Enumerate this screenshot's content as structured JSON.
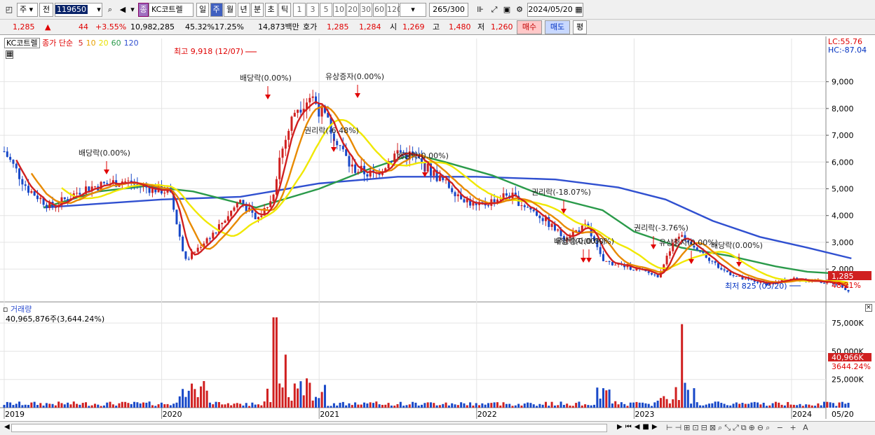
{
  "toolbar": {
    "market": "주",
    "prev": "전",
    "code": "119650",
    "name": "KC코트렐",
    "name_badge": "종",
    "periods": [
      "일",
      "주",
      "월",
      "년",
      "분",
      "초",
      "틱"
    ],
    "nums": [
      "1",
      "3",
      "5",
      "10",
      "20",
      "30",
      "60",
      "120"
    ],
    "count": "265",
    "count_total": "/300",
    "date": "2024/05/20"
  },
  "quote": {
    "price": "1,285",
    "arrow": "▲",
    "change": "44",
    "pct": "+3.55%",
    "volume": "10,982,285",
    "vol_pct": "45.32%",
    "turnover": "17.25%",
    "amount": "14,873백만",
    "ask_label": "호가",
    "ask": "1,285",
    "bid": "1,284",
    "open_label": "시",
    "open": "1,269",
    "high_label": "고",
    "high": "1,480",
    "low_label": "저",
    "low": "1,260",
    "buy": "매수",
    "sell": "매도",
    "eval": "평"
  },
  "legend": {
    "name": "KC코트렐",
    "type": "종가 단순",
    "ma": [
      "5",
      "10",
      "20",
      "60",
      "120"
    ],
    "ma_colors": [
      "#d02020",
      "#e8a000",
      "#e8e000",
      "#2a9a4a",
      "#3050d0"
    ]
  },
  "annotations": {
    "high": "최고 9,918 (12/07)",
    "low": "최저 825 (05/20)",
    "events": [
      "배당락(0.00%)",
      "배당락(0.00%)",
      "유상증자(0.00%)",
      "권리락(-6.48%)",
      "배당락(0.00%)",
      "권리락(-18.07%)",
      "배당락(0.00%)",
      "유상증자(0.00%)",
      "권리락(-3.76%)",
      "유상증자(0.00%)",
      "배당락(0.00%)"
    ]
  },
  "price_axis": {
    "lc": "LC:55.76",
    "hc": "HC:-87.04",
    "ticks": [
      "9,000",
      "8,000",
      "7,000",
      "6,000",
      "5,000",
      "4,000",
      "3,000",
      "2,000"
    ],
    "current": "1,285",
    "current_pct": "48.21%"
  },
  "volume_panel": {
    "title": "거래량",
    "info": "40,965,876주(3,644.24%)",
    "ticks": [
      "75,000K",
      "50,000K",
      "25,000K"
    ],
    "current": "40,966K",
    "current_pct": "3644.24%"
  },
  "x_axis": {
    "labels": [
      "2019",
      "2020",
      "2021",
      "2022",
      "2023",
      "2024"
    ],
    "last": "05/20"
  },
  "colors": {
    "up": "#d02020",
    "down": "#1848c8",
    "ma5": "#d02020",
    "ma10": "#e88a00",
    "ma20": "#f0e800",
    "ma60": "#2a9a4a",
    "ma120": "#3050d0"
  },
  "chart_data": {
    "type": "candlestick",
    "x": [
      "2019",
      "2020",
      "2021",
      "2022",
      "2023",
      "2024"
    ],
    "price_ylim": [
      800,
      10300
    ],
    "ma120_approx": [
      [
        2019.25,
        4300
      ],
      [
        2020.0,
        4600
      ],
      [
        2020.5,
        4700
      ],
      [
        2021.0,
        5200
      ],
      [
        2021.5,
        5450
      ],
      [
        2022.0,
        5450
      ],
      [
        2022.5,
        5350
      ],
      [
        2022.9,
        5050
      ],
      [
        2023.2,
        4600
      ],
      [
        2023.5,
        3800
      ],
      [
        2023.8,
        3200
      ],
      [
        2024.1,
        2800
      ],
      [
        2024.38,
        2400
      ]
    ],
    "ma60_approx": [
      [
        2019.25,
        4300
      ],
      [
        2019.6,
        4900
      ],
      [
        2019.9,
        5100
      ],
      [
        2020.2,
        4900
      ],
      [
        2020.6,
        4300
      ],
      [
        2021.0,
        5000
      ],
      [
        2021.3,
        5700
      ],
      [
        2021.6,
        6300
      ],
      [
        2021.8,
        6000
      ],
      [
        2022.1,
        5500
      ],
      [
        2022.4,
        4800
      ],
      [
        2022.8,
        4200
      ],
      [
        2023.0,
        3400
      ],
      [
        2023.3,
        2800
      ],
      [
        2023.6,
        2500
      ],
      [
        2023.9,
        2100
      ],
      [
        2024.1,
        1900
      ],
      [
        2024.38,
        1800
      ]
    ],
    "volume_ylim": [
      0,
      85000
    ],
    "volume_spikes_k": [
      {
        "x": 2020.72,
        "v": 80000
      },
      {
        "x": 2020.78,
        "v": 47000
      },
      {
        "x": 2023.3,
        "v": 74000
      },
      {
        "x": 2024.38,
        "v": 40966
      }
    ]
  }
}
